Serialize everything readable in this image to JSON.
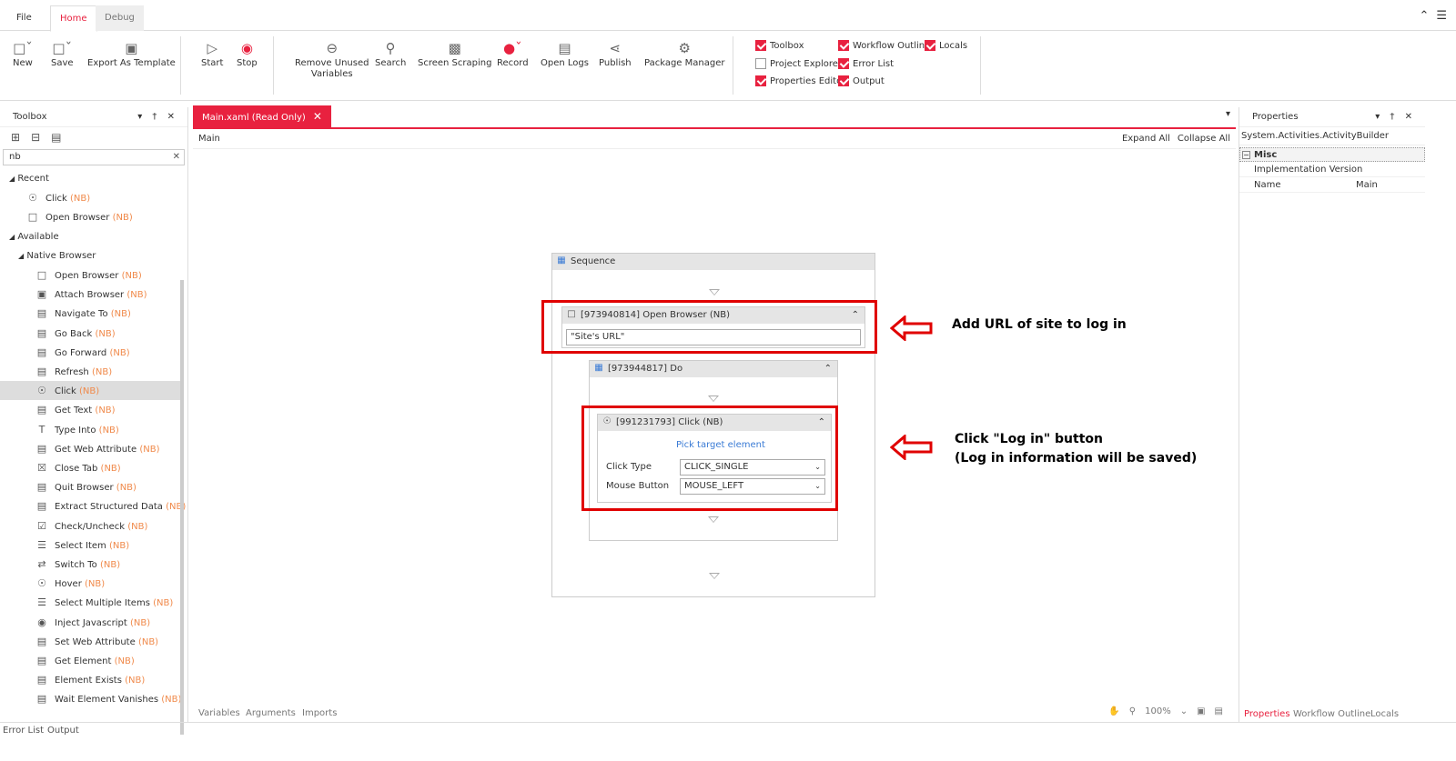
{
  "menu": {
    "file": "File",
    "home": "Home",
    "debug": "Debug"
  },
  "ribbon": {
    "new": "New",
    "save": "Save",
    "export": "Export As Template",
    "start": "Start",
    "stop": "Stop",
    "remove_unused_1": "Remove Unused",
    "remove_unused_2": "Variables",
    "search": "Search",
    "screen_scraping": "Screen Scraping",
    "record": "Record",
    "open_logs": "Open Logs",
    "publish": "Publish",
    "package_manager": "Package Manager"
  },
  "panes": {
    "toolbox": "Toolbox",
    "workflow_outline": "Workflow Outline",
    "locals": "Locals",
    "project_explorer": "Project Explorer",
    "error_list": "Error List",
    "properties_editor": "Properties Editor",
    "output": "Output"
  },
  "toolbox": {
    "title": "Toolbox",
    "search_value": "nb",
    "recent_label": "Recent",
    "available_label": "Available",
    "native_browser_label": "Native Browser",
    "recent": [
      {
        "name": "Click",
        "tag": "(NB)"
      },
      {
        "name": "Open Browser",
        "tag": "(NB)"
      }
    ],
    "items": [
      {
        "name": "Open Browser",
        "tag": "(NB)"
      },
      {
        "name": "Attach Browser",
        "tag": "(NB)"
      },
      {
        "name": "Navigate To",
        "tag": "(NB)"
      },
      {
        "name": "Go Back",
        "tag": "(NB)"
      },
      {
        "name": "Go Forward",
        "tag": "(NB)"
      },
      {
        "name": "Refresh",
        "tag": "(NB)"
      },
      {
        "name": "Click",
        "tag": "(NB)"
      },
      {
        "name": "Get Text",
        "tag": "(NB)"
      },
      {
        "name": "Type Into",
        "tag": "(NB)"
      },
      {
        "name": "Get Web Attribute",
        "tag": "(NB)"
      },
      {
        "name": "Close Tab",
        "tag": "(NB)"
      },
      {
        "name": "Quit Browser",
        "tag": "(NB)"
      },
      {
        "name": "Extract Structured Data",
        "tag": "(NB)"
      },
      {
        "name": "Check/Uncheck",
        "tag": "(NB)"
      },
      {
        "name": "Select Item",
        "tag": "(NB)"
      },
      {
        "name": "Switch To",
        "tag": "(NB)"
      },
      {
        "name": "Hover",
        "tag": "(NB)"
      },
      {
        "name": "Select Multiple Items",
        "tag": "(NB)"
      },
      {
        "name": "Inject Javascript",
        "tag": "(NB)"
      },
      {
        "name": "Set Web Attribute",
        "tag": "(NB)"
      },
      {
        "name": "Get Element",
        "tag": "(NB)"
      },
      {
        "name": "Element Exists",
        "tag": "(NB)"
      },
      {
        "name": "Wait Element Vanishes",
        "tag": "(NB)"
      }
    ]
  },
  "document": {
    "tab": "Main.xaml (Read Only)",
    "breadcrumb": "Main",
    "expand_all": "Expand All",
    "collapse_all": "Collapse All"
  },
  "workflow": {
    "sequence": "Sequence",
    "open_browser": "[973940814] Open Browser (NB)",
    "url_value": "\"Site's URL\"",
    "do": "[973944817] Do",
    "click": "[991231793] Click (NB)",
    "pick_target": "Pick target element",
    "click_type_label": "Click Type",
    "click_type_value": "CLICK_SINGLE",
    "mouse_button_label": "Mouse Button",
    "mouse_button_value": "MOUSE_LEFT"
  },
  "annotations": {
    "url": "Add URL of site to log in",
    "click_1": "Click \"Log in\" button",
    "click_2": "(Log in information will be saved)"
  },
  "bottom": {
    "variables": "Variables",
    "arguments": "Arguments",
    "imports": "Imports",
    "zoom": "100%"
  },
  "properties": {
    "title": "Properties",
    "type": "System.Activities.ActivityBuilder",
    "category": "Misc",
    "rows": [
      {
        "name": "Implementation Version",
        "value": ""
      },
      {
        "name": "Name",
        "value": "Main"
      }
    ],
    "tab_properties": "Properties",
    "tab_outline": "Workflow Outline",
    "tab_locals": "Locals"
  },
  "status": {
    "error_list": "Error List",
    "output": "Output"
  },
  "colors": {
    "accent": "#e8213f",
    "annotation": "#e00000",
    "nb_tag": "#f08a4b"
  }
}
